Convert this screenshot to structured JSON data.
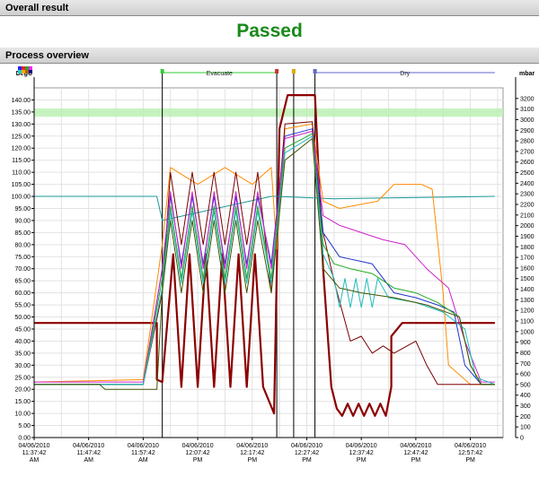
{
  "sections": {
    "overall_result_title": "Overall result",
    "process_overview_title": "Process overview"
  },
  "result": {
    "status": "Passed",
    "status_color": "#1a8a1a"
  },
  "chart_data": {
    "type": "line",
    "left_axis": {
      "unit": "DegC",
      "ylim": [
        0,
        145
      ],
      "ticks": [
        "0.00",
        "5.00",
        "10.00",
        "15.00",
        "20.00",
        "25.00",
        "30.00",
        "35.00",
        "40.00",
        "45.00",
        "50.00",
        "55.00",
        "60.00",
        "65.00",
        "70.00",
        "75.00",
        "80.00",
        "85.00",
        "90.00",
        "95.00",
        "100.00",
        "105.00",
        "110.00",
        "115.00",
        "120.00",
        "125.00",
        "130.00",
        "135.00",
        "140.00"
      ]
    },
    "right_axis": {
      "unit": "mbar",
      "ylim": [
        0,
        3300
      ],
      "ticks": [
        "0",
        "100",
        "200",
        "300",
        "400",
        "500",
        "600",
        "700",
        "800",
        "900",
        "1000",
        "1100",
        "1200",
        "1300",
        "1400",
        "1500",
        "1600",
        "1700",
        "1800",
        "1900",
        "2000",
        "2100",
        "2200",
        "2300",
        "2400",
        "2500",
        "2600",
        "2700",
        "2800",
        "2900",
        "3000",
        "3100",
        "3200"
      ]
    },
    "x_ticks": [
      {
        "t": 0,
        "date": "04/06/2010",
        "time": "11:37:42",
        "ampm": "AM"
      },
      {
        "t": 10,
        "date": "04/06/2010",
        "time": "11:47:42",
        "ampm": "AM"
      },
      {
        "t": 20,
        "date": "04/06/2010",
        "time": "11:57:42",
        "ampm": "AM"
      },
      {
        "t": 30,
        "date": "04/06/2010",
        "time": "12:07:42",
        "ampm": "PM"
      },
      {
        "t": 40,
        "date": "04/06/2010",
        "time": "12:17:42",
        "ampm": "PM"
      },
      {
        "t": 50,
        "date": "04/06/2010",
        "time": "12:27:42",
        "ampm": "PM"
      },
      {
        "t": 60,
        "date": "04/06/2010",
        "time": "12:37:42",
        "ampm": "PM"
      },
      {
        "t": 70,
        "date": "04/06/2010",
        "time": "12:47:42",
        "ampm": "PM"
      },
      {
        "t": 80,
        "date": "04/06/2010",
        "time": "12:57:42",
        "ampm": "PM"
      }
    ],
    "xlim": [
      0,
      86
    ],
    "grid": true,
    "highlight_band": {
      "y_from": 133,
      "y_to": 136.5,
      "color": "#b9f0b0"
    },
    "phase_lines": [
      23.5,
      44.5,
      47.6,
      51.5
    ],
    "phases": [
      {
        "label": "Evacuate",
        "from": 23.5,
        "to": 44.5,
        "color": "#33cc33"
      },
      {
        "label": "Dry",
        "from": 51.5,
        "to": 84.5,
        "color": "#6666cc"
      }
    ],
    "legend_swatches": [
      "#2222ff",
      "#ff2222",
      "#22aa22",
      "#ff22ff",
      "#22cccc",
      "#ffaa00",
      "#aa6600",
      "#000088"
    ],
    "series": [
      {
        "color": "#8b0000",
        "width": 2.2,
        "axis": "left",
        "points": [
          [
            0,
            47.5
          ],
          [
            22.5,
            47.5
          ],
          [
            22.5,
            24
          ],
          [
            23.5,
            23
          ],
          [
            25.5,
            76
          ],
          [
            27,
            21
          ],
          [
            28.5,
            76
          ],
          [
            30,
            21
          ],
          [
            31.5,
            76
          ],
          [
            33,
            21
          ],
          [
            34.5,
            76
          ],
          [
            36,
            21
          ],
          [
            37.5,
            76
          ],
          [
            39,
            21
          ],
          [
            40.5,
            76
          ],
          [
            42,
            21
          ],
          [
            44,
            10
          ],
          [
            45,
            128
          ],
          [
            46.5,
            142
          ],
          [
            51.5,
            142
          ],
          [
            53,
            70
          ],
          [
            54.5,
            21
          ],
          [
            55.5,
            12
          ],
          [
            56.5,
            9
          ],
          [
            57.5,
            14
          ],
          [
            58.5,
            9
          ],
          [
            59.5,
            14
          ],
          [
            60.5,
            9
          ],
          [
            61.5,
            14
          ],
          [
            62.5,
            9
          ],
          [
            63.5,
            14
          ],
          [
            64.5,
            9
          ],
          [
            65.5,
            21
          ],
          [
            65.5,
            42
          ],
          [
            67.5,
            47.5
          ],
          [
            84.5,
            47.5
          ]
        ]
      },
      {
        "color": "#1a9a9a",
        "width": 1,
        "axis": "left",
        "points": [
          [
            0,
            100
          ],
          [
            22.5,
            100
          ],
          [
            23.5,
            90
          ],
          [
            43.5,
            100
          ],
          [
            44.5,
            100
          ],
          [
            55,
            99
          ],
          [
            84.5,
            100
          ]
        ]
      },
      {
        "color": "#ff8c00",
        "width": 1,
        "axis": "left",
        "points": [
          [
            0,
            23
          ],
          [
            20,
            24
          ],
          [
            23.5,
            80
          ],
          [
            25,
            112
          ],
          [
            30,
            105
          ],
          [
            35,
            112
          ],
          [
            40,
            105
          ],
          [
            43.5,
            112
          ],
          [
            44.5,
            78
          ],
          [
            46,
            128
          ],
          [
            51,
            130
          ],
          [
            53,
            98
          ],
          [
            56,
            95
          ],
          [
            63,
            98
          ],
          [
            66,
            105
          ],
          [
            71,
            105
          ],
          [
            73,
            103
          ],
          [
            75,
            60
          ],
          [
            76,
            30
          ],
          [
            80,
            22
          ],
          [
            84.5,
            22
          ]
        ]
      },
      {
        "color": "#7a0000",
        "width": 1,
        "axis": "left",
        "points": [
          [
            0,
            22
          ],
          [
            20,
            22
          ],
          [
            23.5,
            60
          ],
          [
            25,
            110
          ],
          [
            27,
            80
          ],
          [
            29,
            110
          ],
          [
            31,
            80
          ],
          [
            33,
            110
          ],
          [
            35,
            80
          ],
          [
            37,
            110
          ],
          [
            39,
            80
          ],
          [
            41,
            110
          ],
          [
            43.5,
            60
          ],
          [
            46,
            130
          ],
          [
            51,
            131
          ],
          [
            53,
            85
          ],
          [
            55,
            65
          ],
          [
            58,
            40
          ],
          [
            60,
            42
          ],
          [
            62,
            35
          ],
          [
            64,
            38
          ],
          [
            66,
            35
          ],
          [
            70,
            40
          ],
          [
            72,
            30
          ],
          [
            74,
            22
          ],
          [
            84.5,
            22
          ]
        ]
      },
      {
        "color": "#2233cc",
        "width": 1,
        "axis": "left",
        "points": [
          [
            0,
            22
          ],
          [
            20,
            22
          ],
          [
            23.5,
            70
          ],
          [
            25,
            100
          ],
          [
            27,
            72
          ],
          [
            29,
            100
          ],
          [
            31,
            72
          ],
          [
            33,
            100
          ],
          [
            35,
            72
          ],
          [
            37,
            100
          ],
          [
            39,
            72
          ],
          [
            41,
            100
          ],
          [
            43.5,
            72
          ],
          [
            46,
            125
          ],
          [
            51,
            128
          ],
          [
            53,
            85
          ],
          [
            56,
            75
          ],
          [
            62,
            72
          ],
          [
            66,
            60
          ],
          [
            70,
            58
          ],
          [
            74,
            55
          ],
          [
            77,
            52
          ],
          [
            79,
            30
          ],
          [
            82,
            22
          ],
          [
            84.5,
            22
          ]
        ]
      },
      {
        "color": "#cc22cc",
        "width": 1,
        "axis": "left",
        "points": [
          [
            0,
            23
          ],
          [
            20,
            23
          ],
          [
            23.5,
            70
          ],
          [
            25,
            102
          ],
          [
            27,
            70
          ],
          [
            29,
            102
          ],
          [
            31,
            70
          ],
          [
            33,
            102
          ],
          [
            35,
            70
          ],
          [
            37,
            102
          ],
          [
            39,
            70
          ],
          [
            41,
            102
          ],
          [
            43.5,
            70
          ],
          [
            46,
            124
          ],
          [
            51,
            127
          ],
          [
            53,
            92
          ],
          [
            56,
            88
          ],
          [
            60,
            85
          ],
          [
            64,
            82
          ],
          [
            68,
            80
          ],
          [
            72,
            70
          ],
          [
            76,
            62
          ],
          [
            79,
            40
          ],
          [
            82,
            23
          ],
          [
            84.5,
            23
          ]
        ]
      },
      {
        "color": "#22aa22",
        "width": 1,
        "axis": "left",
        "points": [
          [
            0,
            22
          ],
          [
            20,
            22
          ],
          [
            23.5,
            66
          ],
          [
            25,
            96
          ],
          [
            27,
            66
          ],
          [
            29,
            96
          ],
          [
            31,
            66
          ],
          [
            33,
            96
          ],
          [
            35,
            66
          ],
          [
            37,
            96
          ],
          [
            39,
            66
          ],
          [
            41,
            96
          ],
          [
            43.5,
            66
          ],
          [
            46,
            120
          ],
          [
            51,
            126
          ],
          [
            53,
            80
          ],
          [
            55,
            72
          ],
          [
            58,
            70
          ],
          [
            62,
            68
          ],
          [
            66,
            62
          ],
          [
            70,
            60
          ],
          [
            74,
            56
          ],
          [
            78,
            50
          ],
          [
            80,
            30
          ],
          [
            82,
            22
          ],
          [
            84.5,
            22
          ]
        ]
      },
      {
        "color": "#22bbbb",
        "width": 1,
        "axis": "left",
        "points": [
          [
            0,
            22
          ],
          [
            20,
            22
          ],
          [
            23.5,
            62
          ],
          [
            25,
            94
          ],
          [
            27,
            64
          ],
          [
            29,
            94
          ],
          [
            31,
            64
          ],
          [
            33,
            94
          ],
          [
            35,
            64
          ],
          [
            37,
            94
          ],
          [
            39,
            64
          ],
          [
            41,
            94
          ],
          [
            43.5,
            64
          ],
          [
            46,
            118
          ],
          [
            51,
            125
          ],
          [
            53,
            76
          ],
          [
            55,
            66
          ],
          [
            56,
            54
          ],
          [
            57,
            66
          ],
          [
            58,
            54
          ],
          [
            59,
            66
          ],
          [
            60,
            54
          ],
          [
            61,
            66
          ],
          [
            62,
            54
          ],
          [
            63,
            66
          ],
          [
            65,
            58
          ],
          [
            70,
            56
          ],
          [
            75,
            52
          ],
          [
            79,
            45
          ],
          [
            81,
            25
          ],
          [
            84.5,
            22
          ]
        ]
      },
      {
        "color": "#445500",
        "width": 1,
        "axis": "left",
        "points": [
          [
            0,
            22
          ],
          [
            12,
            22
          ],
          [
            13,
            20
          ],
          [
            22.5,
            20
          ],
          [
            23.5,
            60
          ],
          [
            25,
            90
          ],
          [
            27,
            60
          ],
          [
            29,
            90
          ],
          [
            31,
            60
          ],
          [
            33,
            90
          ],
          [
            35,
            60
          ],
          [
            37,
            90
          ],
          [
            39,
            60
          ],
          [
            41,
            90
          ],
          [
            43.5,
            60
          ],
          [
            46,
            115
          ],
          [
            51,
            124
          ],
          [
            53,
            70
          ],
          [
            56,
            62
          ],
          [
            60,
            60
          ],
          [
            66,
            58
          ],
          [
            72,
            55
          ],
          [
            78,
            50
          ],
          [
            80,
            30
          ],
          [
            82,
            22
          ],
          [
            84.5,
            22
          ]
        ]
      }
    ]
  }
}
